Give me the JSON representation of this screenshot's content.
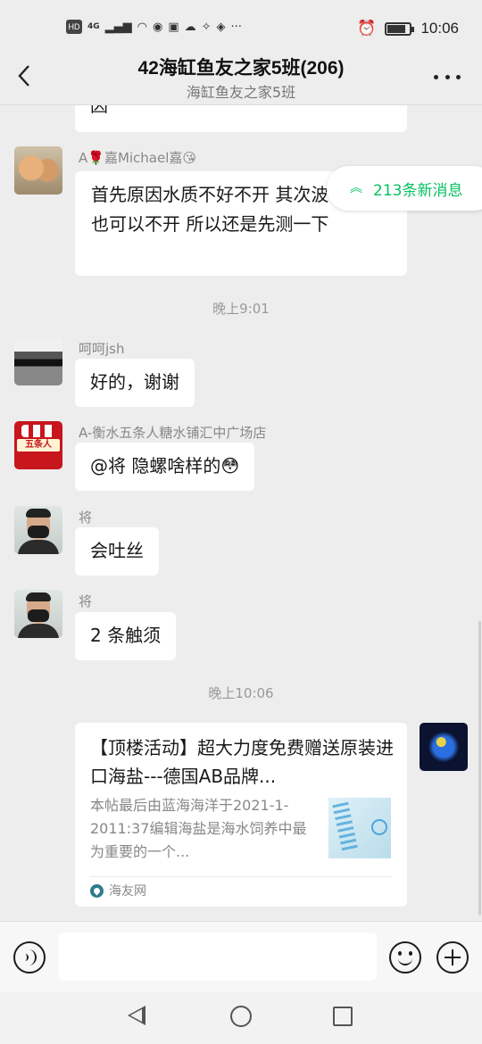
{
  "status_bar": {
    "left_icons": [
      "HD",
      "4G",
      "signal-icon",
      "wifi-icon",
      "qq-icon",
      "app-icon",
      "cloud-icon",
      "app2-icon",
      "nav-icon",
      "more-dots"
    ],
    "hd": "HD",
    "net": "4G",
    "time": "10:06"
  },
  "header": {
    "title": "42海缸鱼友之家5班(206)",
    "subtitle": "海缸鱼友之家5班"
  },
  "messages": [
    {
      "type": "partial",
      "text": "因"
    },
    {
      "sender": "A🌹嘉Michael嘉😘",
      "text": "首先原因水质不好不开 其次波动很大 也可以不开 所以还是先测一下"
    },
    {
      "type": "time",
      "text": "晚上9:01"
    },
    {
      "sender": "呵呵jsh",
      "text": "好的，谢谢"
    },
    {
      "sender": "A-衡水五条人糖水铺汇中广场店",
      "text": "@将  隐螺啥样的😳",
      "avatar_text": "五条人"
    },
    {
      "sender": "将",
      "text": "会吐丝"
    },
    {
      "sender": "将",
      "text": "2 条触须"
    },
    {
      "type": "time",
      "text": "晚上10:06"
    }
  ],
  "new_messages": {
    "label": "213条新消息",
    "color": "#07c160"
  },
  "link_card": {
    "title": "【顶楼活动】超大力度免费赠送原装进口海盐---德国AB品牌...",
    "description": "本帖最后由蓝海海洋于2021-1-2011:37编辑海盐是海水饲养中最为重要的一个...",
    "source": "海友网"
  },
  "colors": {
    "accent": "#07c160",
    "background": "#ededed",
    "bubble": "#ffffff"
  }
}
